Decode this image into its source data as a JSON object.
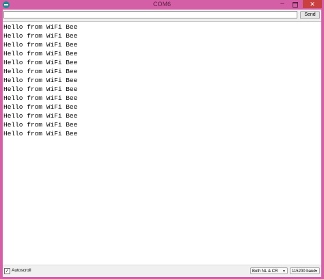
{
  "window": {
    "title": "COM6"
  },
  "controls": {
    "min": "–",
    "max": "",
    "close": "✕"
  },
  "input": {
    "value": ""
  },
  "send_label": "Send",
  "output": {
    "lines": [
      "Hello from WiFi Bee",
      "Hello from WiFi Bee",
      "Hello from WiFi Bee",
      "Hello from WiFi Bee",
      "Hello from WiFi Bee",
      "Hello from WiFi Bee",
      "Hello from WiFi Bee",
      "Hello from WiFi Bee",
      "Hello from WiFi Bee",
      "Hello from WiFi Bee",
      "Hello from WiFi Bee",
      "Hello from WiFi Bee",
      "Hello from WiFi Bee"
    ]
  },
  "status": {
    "autoscroll_label": "Autoscroll",
    "autoscroll_checked": "✓",
    "line_ending": "Both NL & CR",
    "baud": "115200 baud"
  },
  "colors": {
    "frame": "#d55fa6",
    "close": "#c94040"
  }
}
